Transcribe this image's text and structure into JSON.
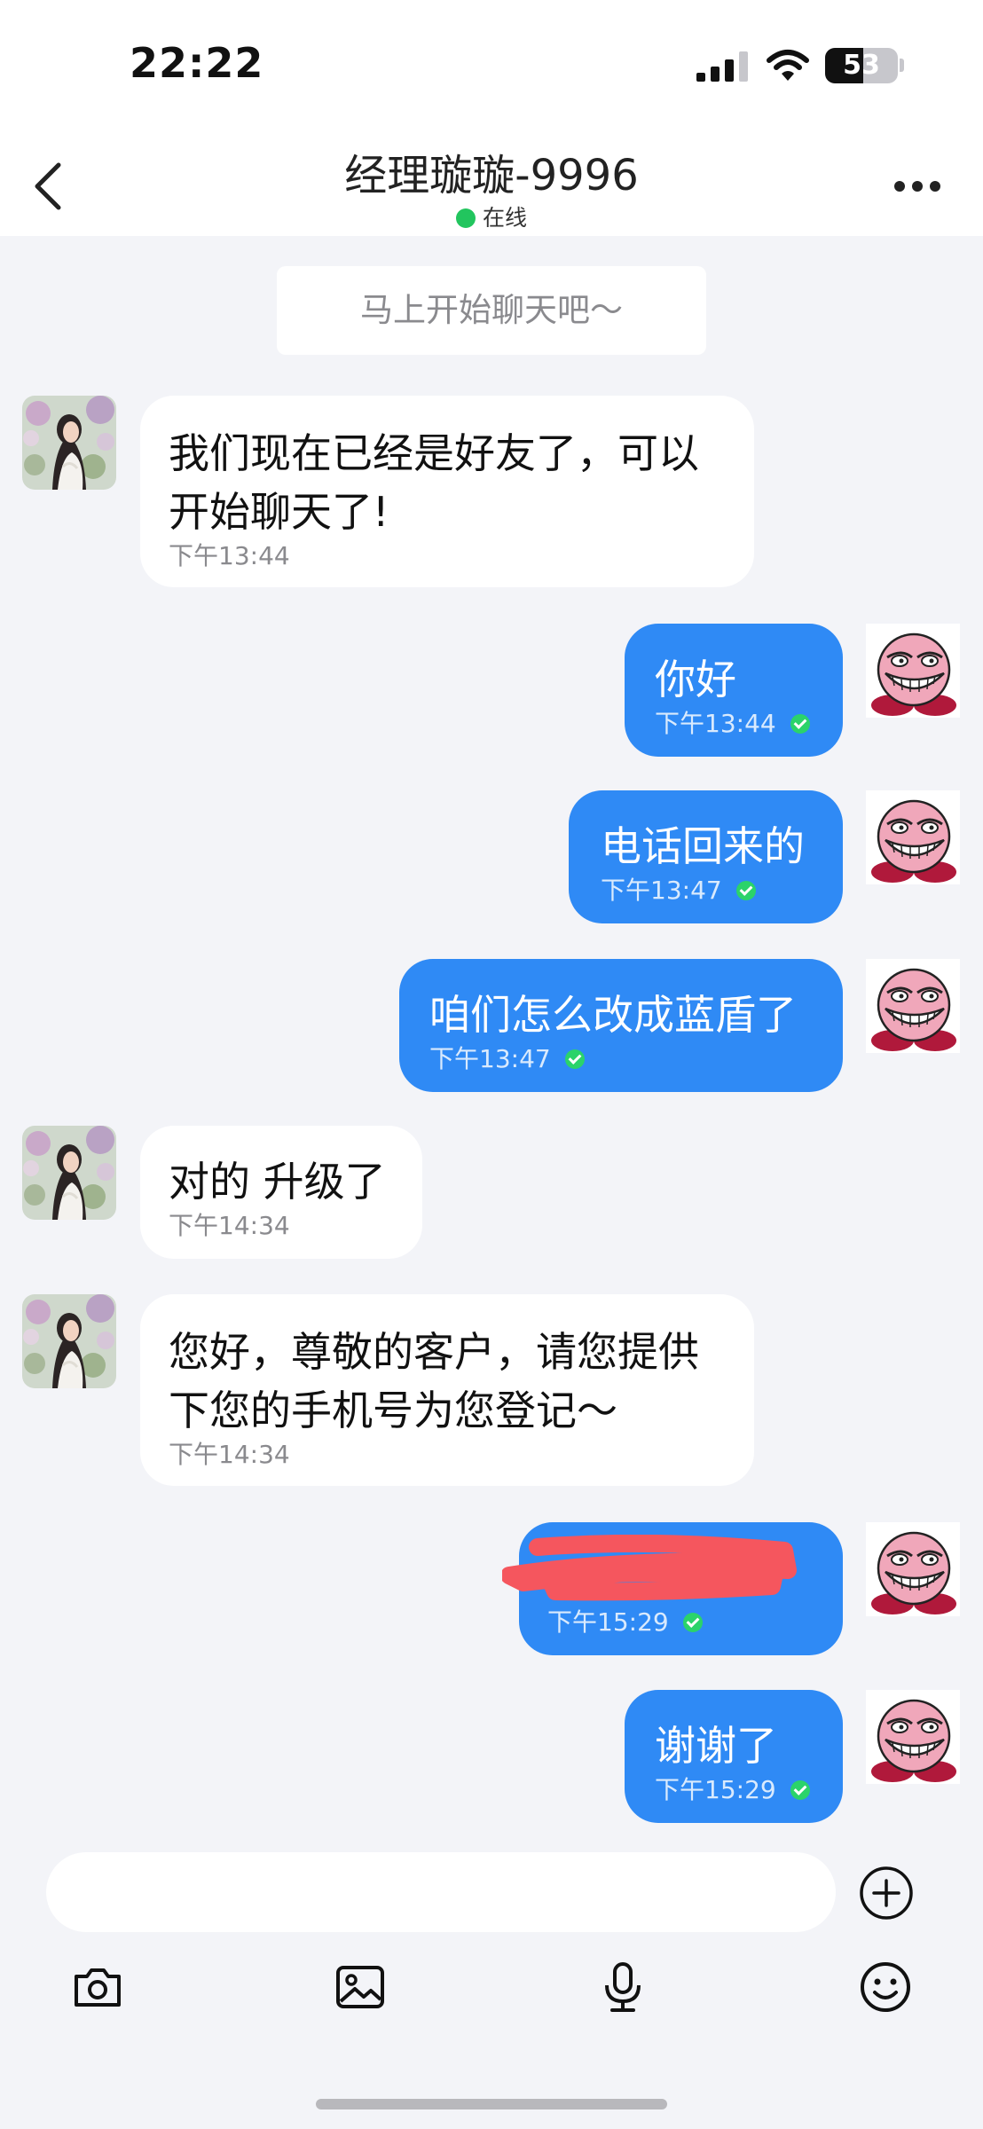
{
  "status_bar": {
    "time": "22:22",
    "battery_percent": 53,
    "battery_label": "53"
  },
  "header": {
    "title": "经理璇璇-9996",
    "status": "在线"
  },
  "system_message": "马上开始聊天吧～",
  "messages": [
    {
      "side": "in",
      "lines": [
        "我们现在已经是好友了，可以",
        "开始聊天了!"
      ],
      "time": "下午13:44"
    },
    {
      "side": "out",
      "lines": [
        "你好"
      ],
      "time": "下午13:44"
    },
    {
      "side": "out",
      "lines": [
        "电话回来的"
      ],
      "time": "下午13:47"
    },
    {
      "side": "out",
      "lines": [
        "咱们怎么改成蓝盾了"
      ],
      "time": "下午13:47"
    },
    {
      "side": "in",
      "lines": [
        "对的 升级了"
      ],
      "time": "下午14:34"
    },
    {
      "side": "in",
      "lines": [
        "您好，尊敬的客户，请您提供",
        "下您的手机号为您登记～"
      ],
      "time": "下午14:34"
    },
    {
      "side": "out",
      "lines": [
        ""
      ],
      "time": "下午15:29",
      "redacted": true
    },
    {
      "side": "out",
      "lines": [
        "谢谢了"
      ],
      "time": "下午15:29"
    }
  ],
  "input": {
    "placeholder": ""
  },
  "toolbar_icons": [
    "camera-icon",
    "image-icon",
    "microphone-icon",
    "emoji-icon"
  ],
  "colors": {
    "accent": "#2f8af5",
    "online": "#22c55e",
    "read_check": "#2bd36a",
    "background": "#f3f4f8"
  }
}
